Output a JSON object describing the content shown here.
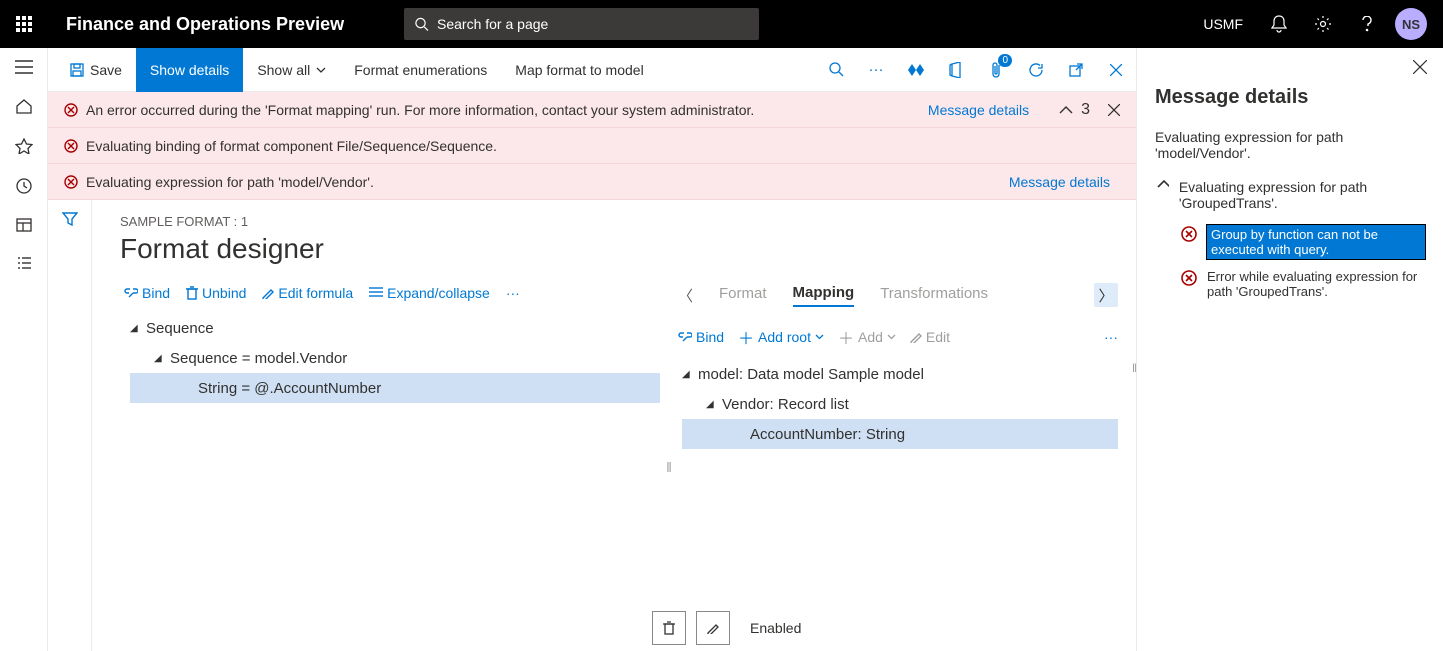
{
  "header": {
    "app_title": "Finance and Operations Preview",
    "search_placeholder": "Search for a page",
    "entity": "USMF",
    "avatar_initials": "NS"
  },
  "actions": {
    "save": "Save",
    "show_details": "Show details",
    "show_all": "Show all",
    "format_enum": "Format enumerations",
    "map_format": "Map format to model",
    "attach_badge": "0"
  },
  "errors": {
    "row1": "An error occurred during the 'Format mapping' run. For more information, contact your system administrator.",
    "row2": "Evaluating binding of format component File/Sequence/Sequence.",
    "row3": "Evaluating expression for path 'model/Vendor'.",
    "details_link": "Message details",
    "count": "3"
  },
  "designer": {
    "breadcrumb": "SAMPLE FORMAT : 1",
    "title": "Format designer",
    "tools": {
      "bind": "Bind",
      "unbind": "Unbind",
      "edit_formula": "Edit formula",
      "expand": "Expand/collapse"
    },
    "tree": {
      "n0": "Sequence",
      "n1": "Sequence = model.Vendor",
      "n2": "String = @.AccountNumber"
    },
    "right_tabs": {
      "format": "Format",
      "mapping": "Mapping",
      "transform": "Transformations"
    },
    "right_tools": {
      "bind": "Bind",
      "add_root": "Add root",
      "add": "Add",
      "edit": "Edit"
    },
    "right_tree": {
      "m0": "model: Data model Sample model",
      "m1": "Vendor: Record list",
      "m2": "AccountNumber: String"
    },
    "bottom": {
      "enabled": "Enabled"
    }
  },
  "msg_pane": {
    "title": "Message details",
    "subtitle": "Evaluating expression for path 'model/Vendor'.",
    "node": "Evaluating expression for path 'GroupedTrans'.",
    "child1": "Group by function can not be executed with query.",
    "child2": "Error while evaluating expression for path 'GroupedTrans'."
  }
}
